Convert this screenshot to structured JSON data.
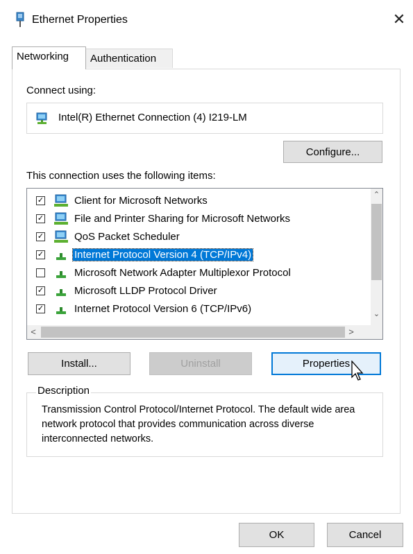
{
  "window": {
    "title": "Ethernet Properties",
    "close_glyph": "✕"
  },
  "tabs": [
    {
      "label": "Networking",
      "active": true
    },
    {
      "label": "Authentication",
      "active": false
    }
  ],
  "connect_using": {
    "label": "Connect using:",
    "adapter_name": "Intel(R) Ethernet Connection (4) I219-LM",
    "adapter_icon": "network-adapter-icon"
  },
  "buttons": {
    "configure": "Configure...",
    "install": "Install...",
    "uninstall": "Uninstall",
    "properties": "Properties",
    "ok": "OK",
    "cancel": "Cancel"
  },
  "items_label": "This connection uses the following items:",
  "items": [
    {
      "label": "Client for Microsoft Networks",
      "checked": true,
      "icon": "network-client-icon",
      "selected": false
    },
    {
      "label": "File and Printer Sharing for Microsoft Networks",
      "checked": true,
      "icon": "network-service-icon",
      "selected": false
    },
    {
      "label": "QoS Packet Scheduler",
      "checked": true,
      "icon": "network-service-icon",
      "selected": false
    },
    {
      "label": "Internet Protocol Version 4 (TCP/IPv4)",
      "checked": true,
      "icon": "protocol-icon",
      "selected": true
    },
    {
      "label": "Microsoft Network Adapter Multiplexor Protocol",
      "checked": false,
      "icon": "protocol-icon",
      "selected": false
    },
    {
      "label": "Microsoft LLDP Protocol Driver",
      "checked": true,
      "icon": "protocol-icon",
      "selected": false
    },
    {
      "label": "Internet Protocol Version 6 (TCP/IPv6)",
      "checked": true,
      "icon": "protocol-icon",
      "selected": false
    }
  ],
  "description": {
    "legend": "Description",
    "text": "Transmission Control Protocol/Internet Protocol. The default wide area network protocol that provides communication across diverse interconnected networks."
  },
  "colors": {
    "accent": "#0078d7",
    "button_face": "#e1e1e1",
    "button_border": "#adadad"
  }
}
